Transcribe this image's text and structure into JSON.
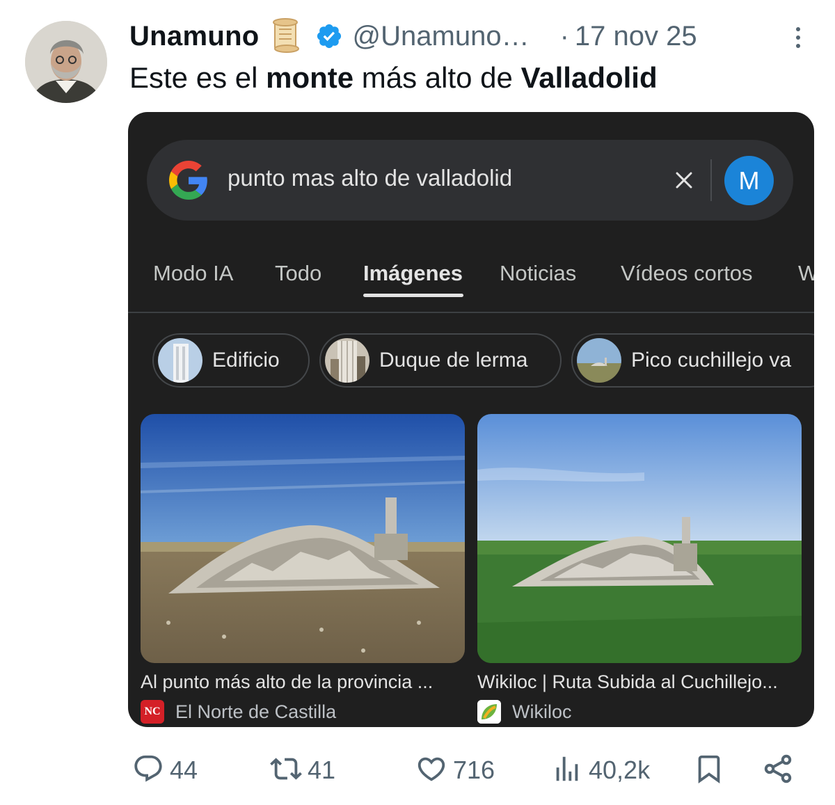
{
  "tweet": {
    "display_name": "Unamuno",
    "handle": "@Unamuno…",
    "dot": "·",
    "date": "17 nov 25",
    "text_parts": [
      "Este es el ",
      "monte",
      " más alto de ",
      "Valladolid"
    ],
    "icons": {
      "name_emoji": "scroll-icon",
      "verified": "verified-badge-icon",
      "more": "more-icon"
    }
  },
  "screenshot": {
    "search_query": "punto mas alto de valladolid",
    "account_initial": "M",
    "tabs": [
      "Modo IA",
      "Todo",
      "Imágenes",
      "Noticias",
      "Vídeos cortos",
      "W"
    ],
    "active_tab": "Imágenes",
    "chips": [
      "Edificio",
      "Duque de lerma",
      "Pico cuchillejo va"
    ],
    "results": [
      {
        "title": "Al punto más alto de la provincia ...",
        "source": "El Norte de Castilla",
        "source_icon_text": "NC"
      },
      {
        "title": "Wikiloc | Ruta Subida al Cuchillejo...",
        "source": "Wikiloc"
      }
    ]
  },
  "actions": {
    "replies": "44",
    "reposts": "41",
    "likes": "716",
    "views": "40,2k"
  },
  "colors": {
    "text": "#0f1419",
    "muted": "#536471",
    "verified": "#1d9bf0",
    "panel": "#1f1f1f",
    "search_bar": "#2f3033",
    "account_avatar": "#1b84d8"
  }
}
